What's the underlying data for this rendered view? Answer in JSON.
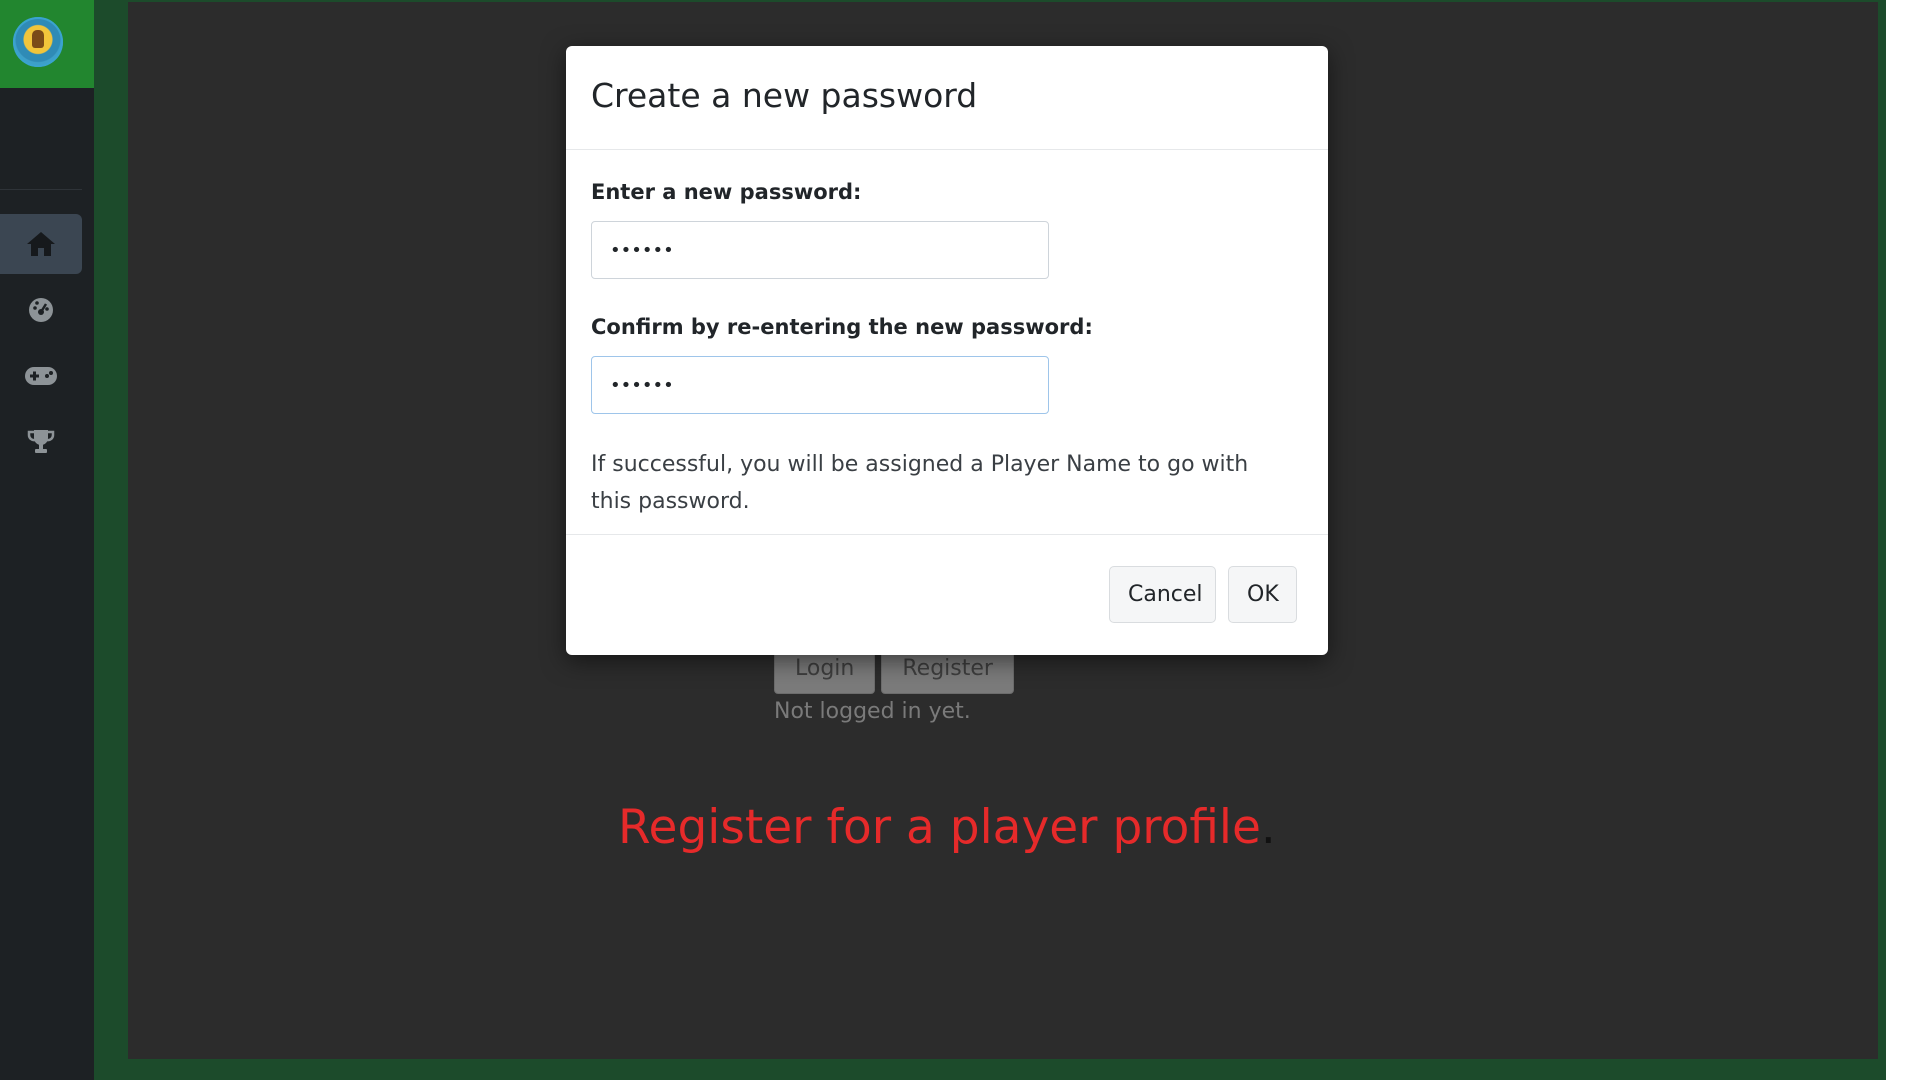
{
  "sidebar": {
    "items": [
      {
        "name": "home",
        "icon": "home-icon",
        "active": true
      },
      {
        "name": "dashboard",
        "icon": "gauge-icon",
        "active": false
      },
      {
        "name": "games",
        "icon": "gamepad-icon",
        "active": false
      },
      {
        "name": "trophies",
        "icon": "trophy-icon",
        "active": false
      }
    ]
  },
  "background": {
    "login_label": "Login",
    "register_label": "Register",
    "status": "Not logged in yet.",
    "headline": "Register for a player profile",
    "headline_suffix": "."
  },
  "modal": {
    "title": "Create a new password",
    "new_password_label": "Enter a new password:",
    "new_password_value": "••••••",
    "confirm_label": "Confirm by re-entering the new password:",
    "confirm_value": "••••••",
    "help_text": "If successful, you will be assigned a Player Name to go with this password.",
    "cancel_label": "Cancel",
    "ok_label": "OK"
  },
  "colors": {
    "accent_green": "#22862f",
    "headline_red": "#e62a2a",
    "frame_green": "#1c4b2b"
  }
}
